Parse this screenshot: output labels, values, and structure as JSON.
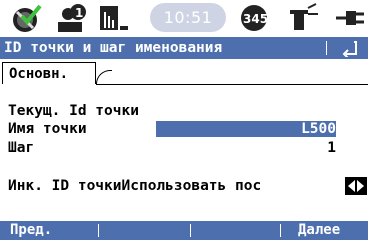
{
  "status_bar": {
    "time": "10:51",
    "satellites_label": "345",
    "icons": [
      "satellite-check-icon",
      "user-info-icon",
      "data-bars-icon",
      "satellite-count-icon",
      "antenna-icon",
      "plug-icon"
    ]
  },
  "title_bar": {
    "title": "ID точки и шаг именования",
    "back_icon": "return-icon"
  },
  "tabs": [
    {
      "label": "Основн."
    }
  ],
  "form": {
    "current_id_label": "Текущ. Id точки",
    "point_name_label": "Имя точки",
    "point_name_value": "L500",
    "step_label": "Шаг",
    "step_value": "1",
    "increment_label": "Инк. ID точки",
    "increment_value": "Использовать пос"
  },
  "softkeys": {
    "prev": "Пред.",
    "next": "Далее"
  },
  "colors": {
    "accent": "#4d6fae",
    "clock_bg": "#cfd4e4",
    "check_green": "#3cc33c"
  }
}
